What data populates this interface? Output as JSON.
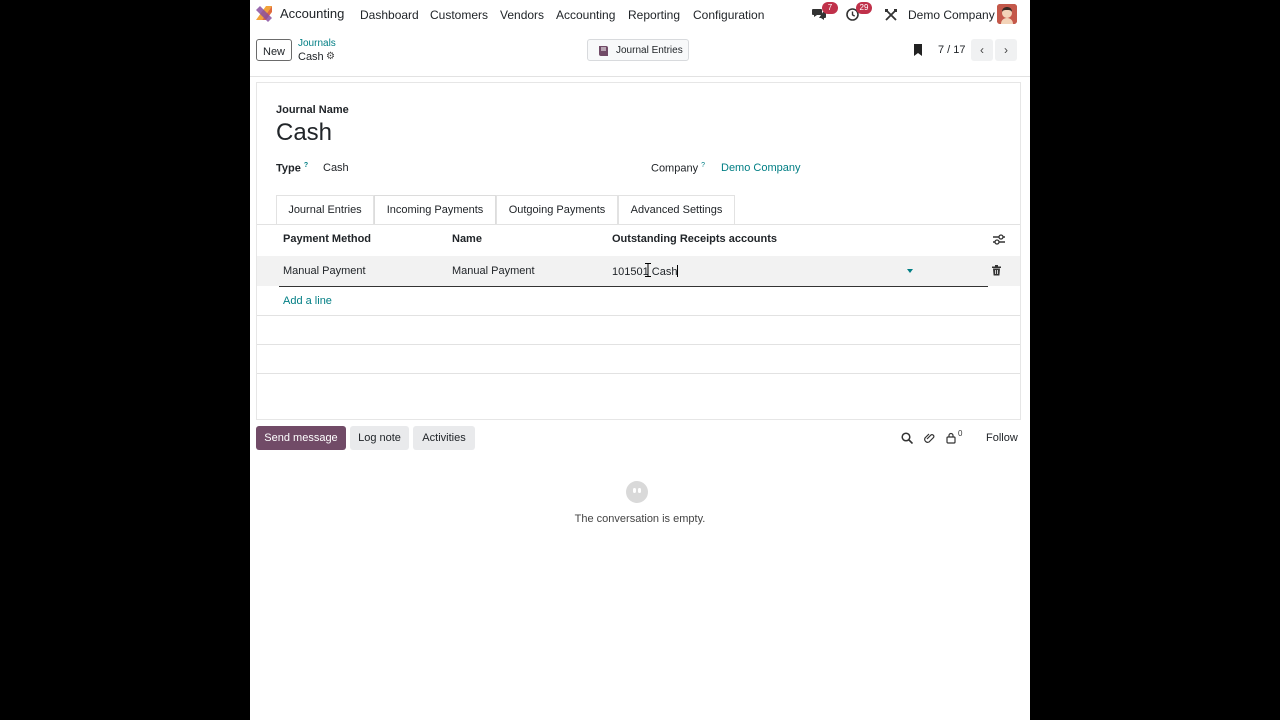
{
  "navbar": {
    "app_name": "Accounting",
    "menu": [
      "Dashboard",
      "Customers",
      "Vendors",
      "Accounting",
      "Reporting",
      "Configuration"
    ],
    "messages_count": "7",
    "activities_count": "29",
    "company": "Demo Company"
  },
  "control": {
    "new_label": "New",
    "breadcrumb_parent": "Journals",
    "breadcrumb_current": "Cash",
    "smart_button_label": "Journal Entries",
    "pager": "7 / 17"
  },
  "form": {
    "journal_name_label": "Journal Name",
    "journal_name": "Cash",
    "type_label": "Type",
    "type_value": "Cash",
    "company_label": "Company",
    "company_value": "Demo Company",
    "help_mark": "?",
    "tabs": [
      "Journal Entries",
      "Incoming Payments",
      "Outgoing Payments",
      "Advanced Settings"
    ],
    "active_tab": "Incoming Payments",
    "table": {
      "headers": [
        "Payment Method",
        "Name",
        "Outstanding Receipts accounts"
      ],
      "rows": [
        {
          "payment_method": "Manual Payment",
          "name": "Manual Payment",
          "account": "101501 Cash"
        }
      ],
      "add_line": "Add a line"
    }
  },
  "chatter": {
    "send_message": "Send message",
    "log_note": "Log note",
    "activities": "Activities",
    "followers_count": "0",
    "follow": "Follow",
    "empty_text": "The conversation is empty."
  },
  "colors": {
    "brand": "#714b67",
    "link": "#017e84",
    "badge": "#c0314a"
  }
}
